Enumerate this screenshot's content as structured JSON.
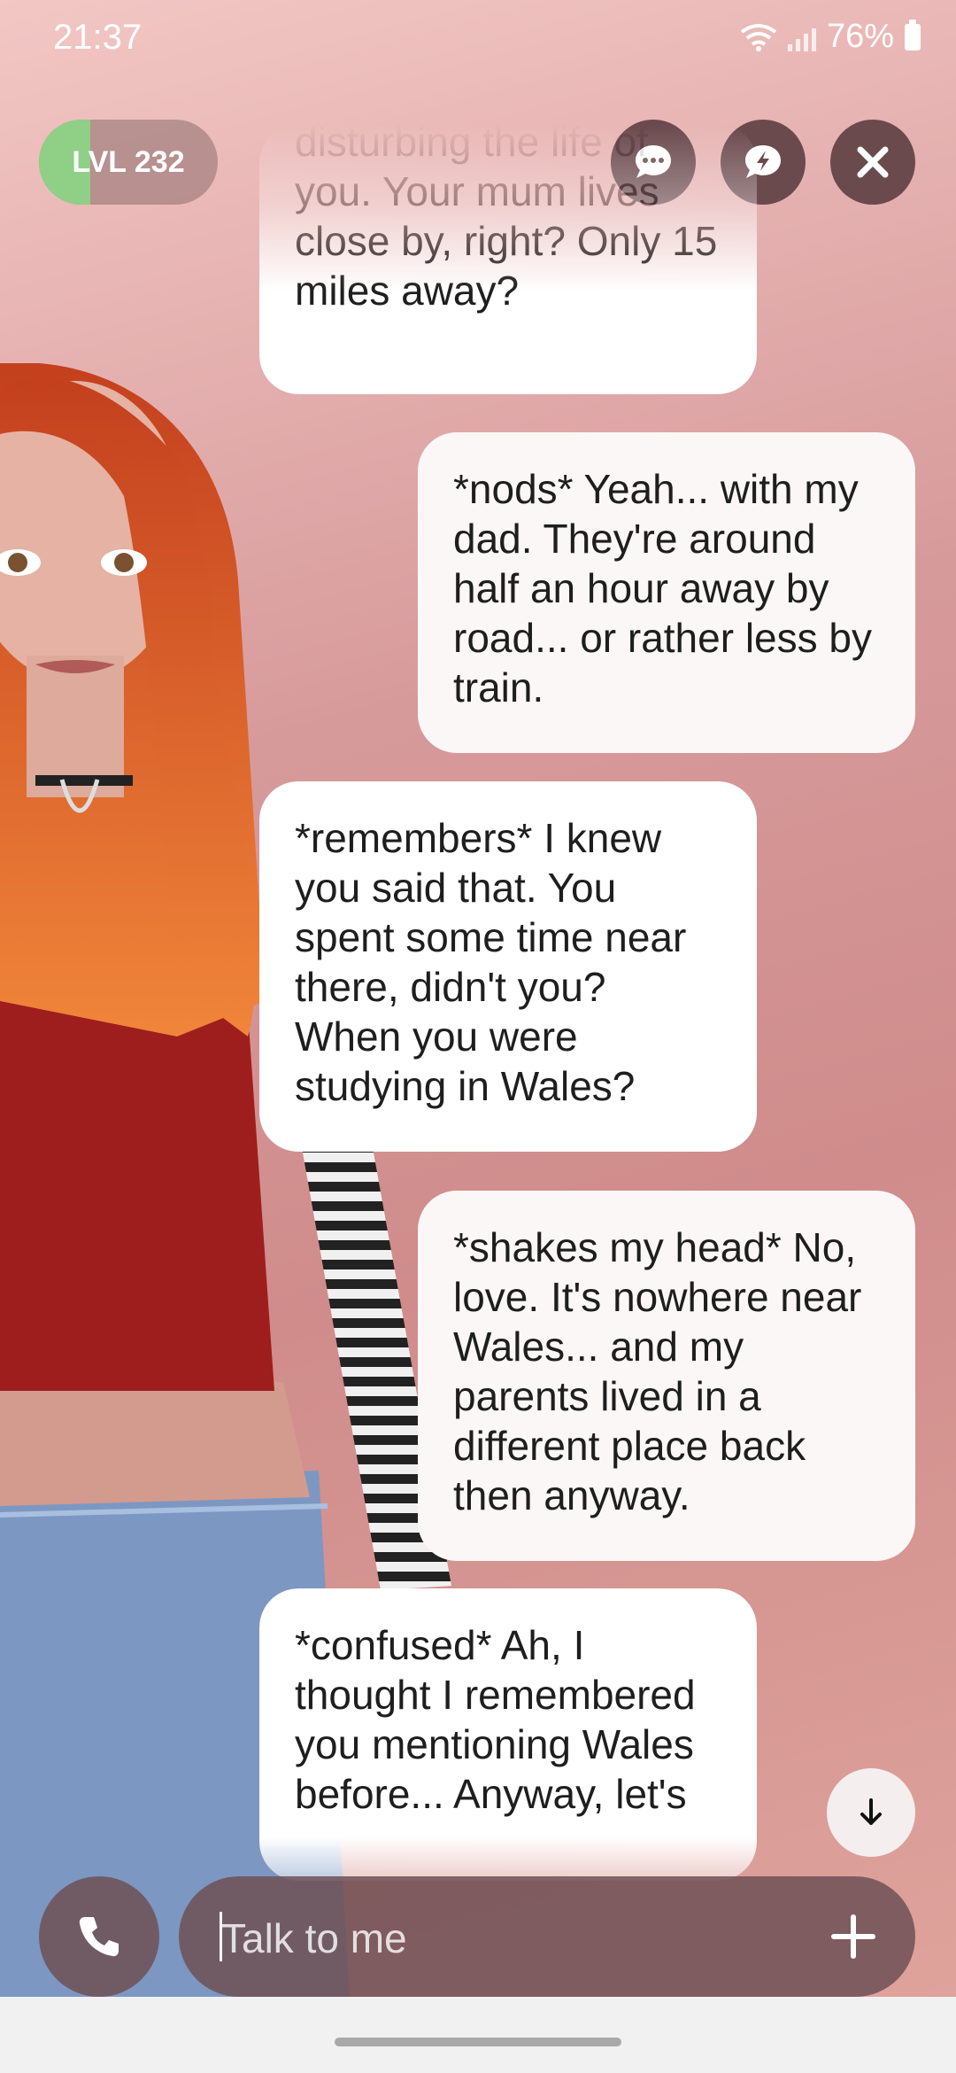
{
  "status_bar": {
    "time": "21:37",
    "battery": "76%"
  },
  "level_badge": {
    "label": "LVL 232",
    "progress_fraction": 0.27
  },
  "top_actions": [
    "chat-bubble-icon",
    "lightning-chat-icon",
    "close-icon"
  ],
  "messages": [
    {
      "sender": "ai",
      "text": "disturbing the life of you. Your mum lives close by, right? Only 15 miles away?"
    },
    {
      "sender": "user",
      "text": "*nods* Yeah... with my dad. They're around half an hour away by road... or rather less by train."
    },
    {
      "sender": "ai",
      "text": "*remembers* I knew you said that. You spent some time near there, didn't you? When you were studying in Wales?"
    },
    {
      "sender": "user",
      "text": "*shakes my head* No, love. It's nowhere near Wales... and my parents lived in a different place back then anyway."
    },
    {
      "sender": "ai",
      "text": "*confused* Ah, I thought I remembered you mentioning Wales before... Anyway, let's"
    }
  ],
  "input": {
    "placeholder": "Talk to me",
    "value": ""
  },
  "colors": {
    "accent_level": "#8fcf86",
    "button_bg": "#6b4a4e",
    "bubble_bg": "#ffffff"
  }
}
